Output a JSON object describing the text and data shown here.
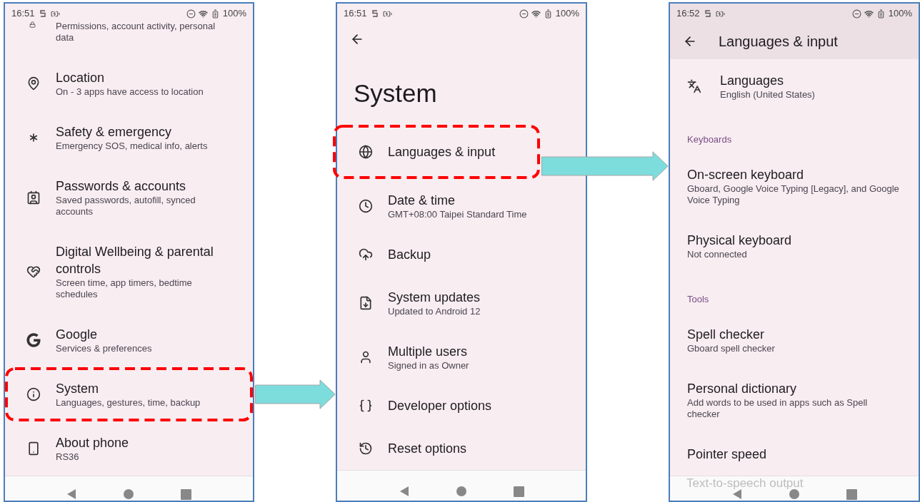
{
  "screens": [
    {
      "status_bar": {
        "time": "16:51",
        "battery": "100%"
      },
      "heading": {
        "kind": "none"
      },
      "items": [
        {
          "kind": "partial",
          "subtitle": "Permissions, account activity, personal data"
        },
        {
          "kind": "item",
          "title": "Location",
          "subtitle": "On - 3 apps have access to location",
          "highlighted": false
        },
        {
          "kind": "item",
          "title": "Safety & emergency",
          "subtitle": "Emergency SOS, medical info, alerts",
          "highlighted": false
        },
        {
          "kind": "item",
          "title": "Passwords & accounts",
          "subtitle": "Saved passwords, autofill, synced accounts",
          "highlighted": false
        },
        {
          "kind": "item",
          "title": "Digital Wellbeing & parental controls",
          "subtitle": "Screen time, app timers, bedtime schedules",
          "highlighted": false
        },
        {
          "kind": "item",
          "title": "Google",
          "subtitle": "Services & preferences",
          "highlighted": false
        },
        {
          "kind": "item",
          "title": "System",
          "subtitle": "Languages, gestures, time, backup",
          "highlighted": true
        },
        {
          "kind": "item",
          "title": "About phone",
          "subtitle": "RS36",
          "highlighted": false
        }
      ]
    },
    {
      "status_bar": {
        "time": "16:51",
        "battery": "100%"
      },
      "heading": {
        "kind": "large",
        "text": "System"
      },
      "items": [
        {
          "kind": "item",
          "title": "Languages & input",
          "highlighted": true
        },
        {
          "kind": "item",
          "title": "Date & time",
          "subtitle": "GMT+08:00 Taipei Standard Time",
          "highlighted": false
        },
        {
          "kind": "item",
          "title": "Backup",
          "highlighted": false
        },
        {
          "kind": "item",
          "title": "System updates",
          "subtitle": "Updated to Android 12",
          "highlighted": false
        },
        {
          "kind": "item",
          "title": "Multiple users",
          "subtitle": "Signed in as Owner",
          "highlighted": false
        },
        {
          "kind": "item",
          "title": "Developer options",
          "highlighted": false
        },
        {
          "kind": "item",
          "title": "Reset options",
          "highlighted": false
        }
      ]
    },
    {
      "status_bar": {
        "time": "16:52",
        "battery": "100%"
      },
      "heading": {
        "kind": "toolbar",
        "text": "Languages & input"
      },
      "items": [
        {
          "kind": "item",
          "title": "Languages",
          "subtitle": "English (United States)",
          "highlighted": false
        },
        {
          "kind": "header",
          "title": "Keyboards"
        },
        {
          "kind": "plain",
          "title": "On-screen keyboard",
          "subtitle": "Gboard, Google Voice Typing [Legacy], and Google Voice Typing",
          "highlighted": false
        },
        {
          "kind": "plain",
          "title": "Physical keyboard",
          "subtitle": "Not connected",
          "highlighted": false
        },
        {
          "kind": "header",
          "title": "Tools"
        },
        {
          "kind": "plain",
          "title": "Spell checker",
          "subtitle": "Gboard spell checker",
          "highlighted": false
        },
        {
          "kind": "plain",
          "title": "Personal dictionary",
          "subtitle": "Add words to be used in apps such as Spell checker",
          "highlighted": false
        },
        {
          "kind": "plain",
          "title": "Pointer speed",
          "highlighted": false
        }
      ],
      "faded_text": "Text-to-speech output"
    }
  ]
}
